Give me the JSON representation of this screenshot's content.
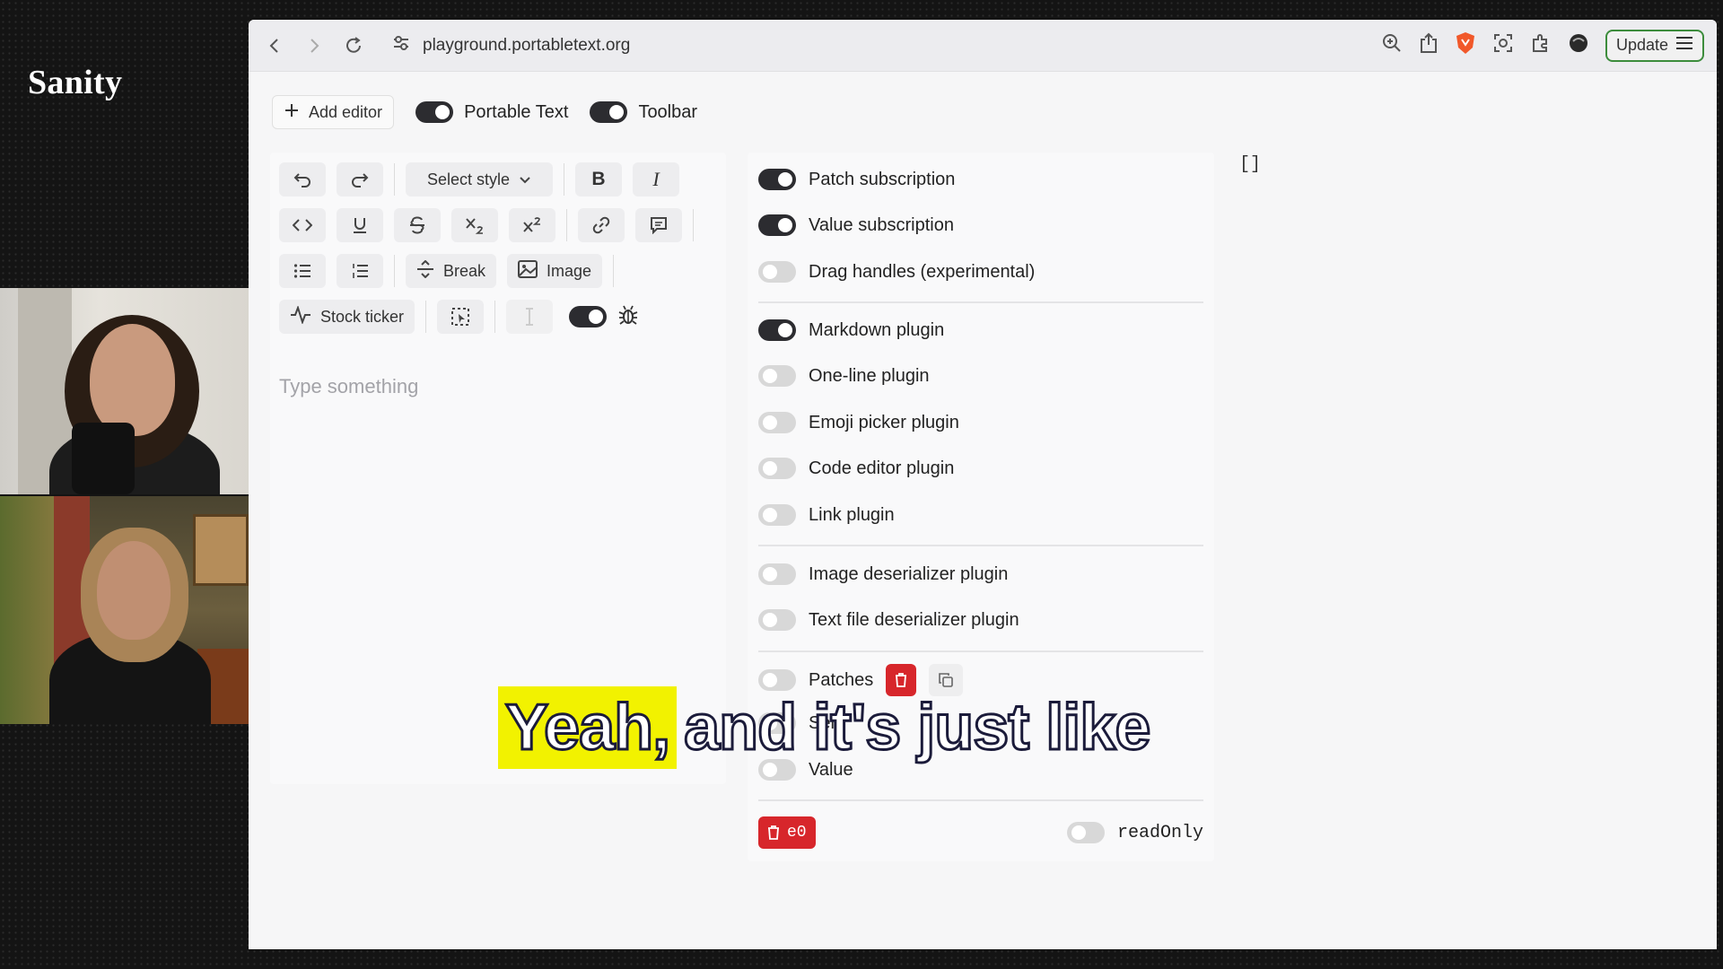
{
  "brand": {
    "name": "Sanity"
  },
  "browser": {
    "url": "playground.portabletext.org",
    "update_label": "Update"
  },
  "controls": {
    "add_editor": "Add editor",
    "portable_text": "Portable Text",
    "toolbar": "Toolbar"
  },
  "toolbar": {
    "select_style": "Select style",
    "bold": "B",
    "italic": "I",
    "break": "Break",
    "image": "Image",
    "stock_ticker": "Stock ticker"
  },
  "editor": {
    "placeholder": "Type something"
  },
  "options": {
    "patch_subscription": "Patch subscription",
    "value_subscription": "Value subscription",
    "drag_handles": "Drag handles (experimental)",
    "markdown": "Markdown plugin",
    "one_line": "One-line plugin",
    "emoji": "Emoji picker plugin",
    "code_editor": "Code editor plugin",
    "link": "Link plugin",
    "image_deserializer": "Image deserializer plugin",
    "text_file_deserializer": "Text file deserializer plugin",
    "patches": "Patches",
    "selection": "Sele",
    "value": "Value",
    "editor_id": "e0",
    "read_only": "readOnly"
  },
  "output": {
    "json": "[]"
  },
  "caption": {
    "highlight": "Yeah,",
    "rest": "and it's just like"
  }
}
